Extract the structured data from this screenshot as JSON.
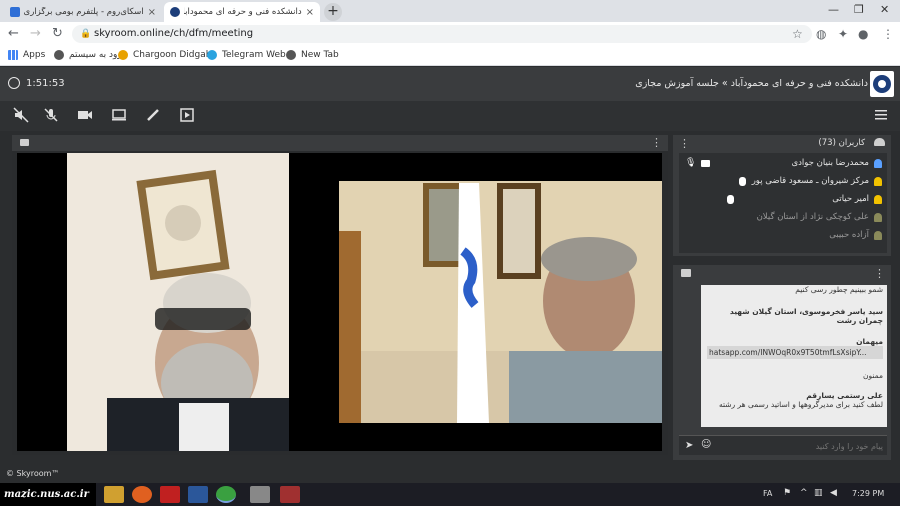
{
  "browser": {
    "tabs": [
      {
        "title": "اسکای‌روم - پلتفرم بومی برگزاری وبینار، ا",
        "active": false
      },
      {
        "title": "دانشکده فنی و حرفه ای محمودآباد » جلسه",
        "active": true
      }
    ],
    "url": "skyroom.online/ch/dfm/meeting",
    "bookmarks": [
      "Apps",
      "ورود به سیستم",
      "Chargoon Didgah",
      "Telegram Web",
      "New Tab"
    ]
  },
  "app": {
    "timer": "1:51:53",
    "breadcrumb": "دانشکده فنی و حرفه ای محمودآباد » جلسه آموزش مجازی",
    "footer_brand": "© Skyroom™"
  },
  "users": {
    "header": "کاربران (73)",
    "list": [
      {
        "name": "محمدرضا بنیان جوادی",
        "status_color": "#5aa0ff"
      },
      {
        "name": "مرکز شیروان ـ مسعود قاضی پور",
        "status_color": "#f2c200"
      },
      {
        "name": "امیر حیاتی",
        "status_color": "#f2c200"
      },
      {
        "name": "علی کوچکی نژاد از استان گیلان",
        "status_color": "#8a8a5a"
      },
      {
        "name": "آزاده حبیبی",
        "status_color": "#8a8a5a"
      }
    ]
  },
  "chat": {
    "messages": [
      {
        "sender": "",
        "text": "شمو ببینیم چطور رسی کنیم"
      },
      {
        "sender": "سید یاسر فخرموسوی، استان گیلان شهید چمران رشت",
        "text": ""
      },
      {
        "sender": "میهمان",
        "text": "hatsapp.com/INWOqR0x9T50tmfLsXsipY..."
      },
      {
        "sender": "",
        "text": "ممنون"
      },
      {
        "sender": "علی رستمی یسارقم",
        "text": "لطف کنید برای مدیرگروهها و اساتید رسمی هر رشته"
      }
    ],
    "input_placeholder": "پیام خود را وارد کنید"
  },
  "taskbar": {
    "watermark": "mazic.nus.ac.ir",
    "lang": "FA",
    "time": "7:29 PM"
  },
  "colors": {
    "accent": "#5aa0ff",
    "header_bg": "#3a3c3e",
    "panel_bg": "#2a2c2e"
  }
}
